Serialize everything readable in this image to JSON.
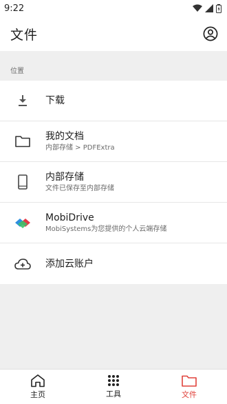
{
  "status_bar": {
    "time": "9:22"
  },
  "app_bar": {
    "title": "文件"
  },
  "section": {
    "header": "位置"
  },
  "locations": [
    {
      "title": "下载",
      "subtitle": "",
      "icon": "download-icon"
    },
    {
      "title": "我的文档",
      "subtitle": "内部存储 > PDFExtra",
      "icon": "folder-icon"
    },
    {
      "title": "内部存储",
      "subtitle": "文件已保存至内部存储",
      "icon": "phone-icon"
    },
    {
      "title": "MobiDrive",
      "subtitle": "MobiSystems为您提供的个人云端存储",
      "icon": "mobidrive-logo-icon"
    },
    {
      "title": "添加云账户",
      "subtitle": "",
      "icon": "cloud-add-icon"
    }
  ],
  "bottom_nav": [
    {
      "label": "主页",
      "icon": "home-icon"
    },
    {
      "label": "工具",
      "icon": "grid-icon"
    },
    {
      "label": "文件",
      "icon": "folder-icon"
    }
  ],
  "colors": {
    "accent": "#e0413a",
    "background": "#efefef"
  }
}
